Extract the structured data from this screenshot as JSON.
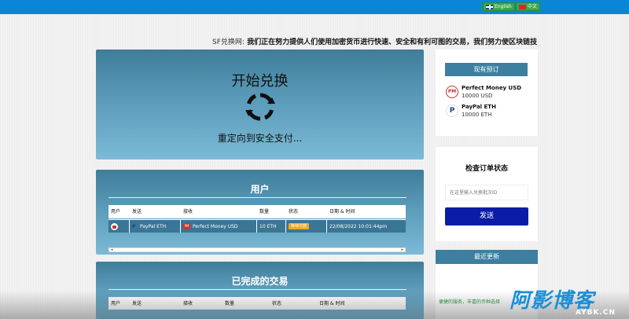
{
  "topbar": {
    "lang_en": "English",
    "lang_cn": "中文"
  },
  "marquee": {
    "prefix": "SF兑换网:",
    "text": "我们正在努力提供人们使用加密货币进行快速、安全和有利可图的交易，我们努力使区块链技"
  },
  "hero": {
    "title": "开始兑换",
    "subtitle": "重定向到安全支付..."
  },
  "users_panel": {
    "title": "用户",
    "columns": [
      "用户",
      "发送",
      "接收",
      "数量",
      "状态",
      "日期 & 时间"
    ],
    "rows": [
      {
        "send": "PayPal ETH",
        "receive": "Perfect Money USD",
        "amount": "10 ETH",
        "status": "等待付款",
        "datetime": "22/08/2022 10:01:44pm"
      }
    ]
  },
  "completed_panel": {
    "title": "已完成的交易",
    "columns": [
      "用户",
      "发送",
      "接收",
      "数量",
      "状态",
      "日期 & 时间"
    ]
  },
  "reserves": {
    "title": "现有预订",
    "items": [
      {
        "name": "Perfect Money USD",
        "amount": "10000 USD",
        "logo": "PM"
      },
      {
        "name": "PayPal ETH",
        "amount": "10000 ETH",
        "logo": "P"
      }
    ]
  },
  "check_order": {
    "title": "检查订单状态",
    "placeholder": "在这里输入兑换批次ID",
    "button": "发送"
  },
  "updates": {
    "title": "最近更新",
    "text": "便捷的服务，丰富的币种选择"
  },
  "watermark": {
    "cn": "阿影博客",
    "en": "AYBK.CN"
  },
  "colors": {
    "topbar": "#0b86d6",
    "panel_dark": "#3f7d9a",
    "panel_light": "#7cbad6",
    "button": "#0b1da6",
    "status_badge": "#f5a524"
  }
}
